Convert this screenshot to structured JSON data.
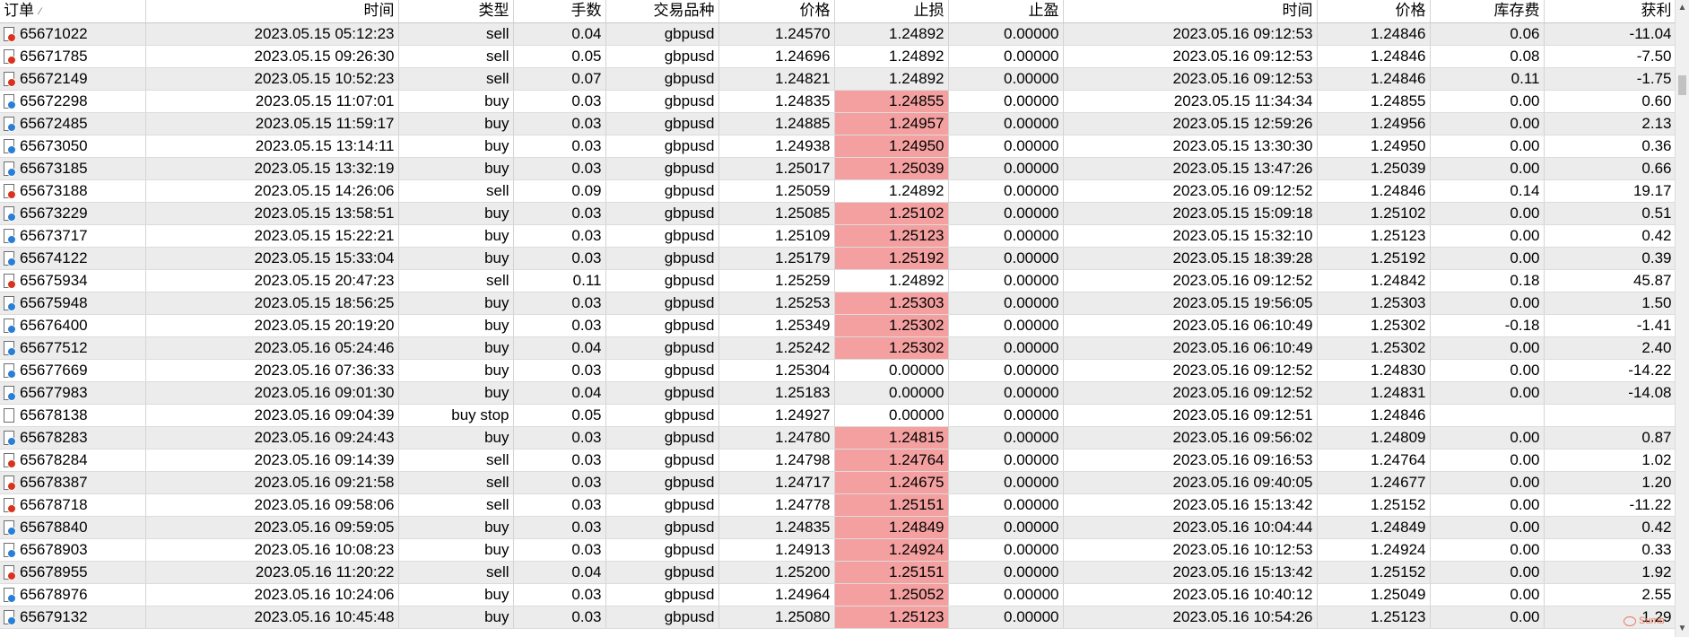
{
  "columns": {
    "order": "订单",
    "time_open": "时间",
    "type": "类型",
    "lots": "手数",
    "symbol": "交易品种",
    "price_open": "价格",
    "sl": "止损",
    "tp": "止盈",
    "time_close": "时间",
    "price_close": "价格",
    "swap": "库存费",
    "profit": "获利"
  },
  "sort_indicator": "⁄",
  "highlight_color": "#f4a0a0",
  "watermark": "Sumb",
  "rows": [
    {
      "order": "65671022",
      "time_open": "2023.05.15 05:12:23",
      "type": "sell",
      "lots": "0.04",
      "symbol": "gbpusd",
      "price_open": "1.24570",
      "sl": "1.24892",
      "tp": "0.00000",
      "time_close": "2023.05.16 09:12:53",
      "price_close": "1.24846",
      "swap": "0.06",
      "profit": "-11.04",
      "sl_hl": false
    },
    {
      "order": "65671785",
      "time_open": "2023.05.15 09:26:30",
      "type": "sell",
      "lots": "0.05",
      "symbol": "gbpusd",
      "price_open": "1.24696",
      "sl": "1.24892",
      "tp": "0.00000",
      "time_close": "2023.05.16 09:12:53",
      "price_close": "1.24846",
      "swap": "0.08",
      "profit": "-7.50",
      "sl_hl": false
    },
    {
      "order": "65672149",
      "time_open": "2023.05.15 10:52:23",
      "type": "sell",
      "lots": "0.07",
      "symbol": "gbpusd",
      "price_open": "1.24821",
      "sl": "1.24892",
      "tp": "0.00000",
      "time_close": "2023.05.16 09:12:53",
      "price_close": "1.24846",
      "swap": "0.11",
      "profit": "-1.75",
      "sl_hl": false
    },
    {
      "order": "65672298",
      "time_open": "2023.05.15 11:07:01",
      "type": "buy",
      "lots": "0.03",
      "symbol": "gbpusd",
      "price_open": "1.24835",
      "sl": "1.24855",
      "tp": "0.00000",
      "time_close": "2023.05.15 11:34:34",
      "price_close": "1.24855",
      "swap": "0.00",
      "profit": "0.60",
      "sl_hl": true
    },
    {
      "order": "65672485",
      "time_open": "2023.05.15 11:59:17",
      "type": "buy",
      "lots": "0.03",
      "symbol": "gbpusd",
      "price_open": "1.24885",
      "sl": "1.24957",
      "tp": "0.00000",
      "time_close": "2023.05.15 12:59:26",
      "price_close": "1.24956",
      "swap": "0.00",
      "profit": "2.13",
      "sl_hl": true
    },
    {
      "order": "65673050",
      "time_open": "2023.05.15 13:14:11",
      "type": "buy",
      "lots": "0.03",
      "symbol": "gbpusd",
      "price_open": "1.24938",
      "sl": "1.24950",
      "tp": "0.00000",
      "time_close": "2023.05.15 13:30:30",
      "price_close": "1.24950",
      "swap": "0.00",
      "profit": "0.36",
      "sl_hl": true
    },
    {
      "order": "65673185",
      "time_open": "2023.05.15 13:32:19",
      "type": "buy",
      "lots": "0.03",
      "symbol": "gbpusd",
      "price_open": "1.25017",
      "sl": "1.25039",
      "tp": "0.00000",
      "time_close": "2023.05.15 13:47:26",
      "price_close": "1.25039",
      "swap": "0.00",
      "profit": "0.66",
      "sl_hl": true
    },
    {
      "order": "65673188",
      "time_open": "2023.05.15 14:26:06",
      "type": "sell",
      "lots": "0.09",
      "symbol": "gbpusd",
      "price_open": "1.25059",
      "sl": "1.24892",
      "tp": "0.00000",
      "time_close": "2023.05.16 09:12:52",
      "price_close": "1.24846",
      "swap": "0.14",
      "profit": "19.17",
      "sl_hl": false
    },
    {
      "order": "65673229",
      "time_open": "2023.05.15 13:58:51",
      "type": "buy",
      "lots": "0.03",
      "symbol": "gbpusd",
      "price_open": "1.25085",
      "sl": "1.25102",
      "tp": "0.00000",
      "time_close": "2023.05.15 15:09:18",
      "price_close": "1.25102",
      "swap": "0.00",
      "profit": "0.51",
      "sl_hl": true
    },
    {
      "order": "65673717",
      "time_open": "2023.05.15 15:22:21",
      "type": "buy",
      "lots": "0.03",
      "symbol": "gbpusd",
      "price_open": "1.25109",
      "sl": "1.25123",
      "tp": "0.00000",
      "time_close": "2023.05.15 15:32:10",
      "price_close": "1.25123",
      "swap": "0.00",
      "profit": "0.42",
      "sl_hl": true
    },
    {
      "order": "65674122",
      "time_open": "2023.05.15 15:33:04",
      "type": "buy",
      "lots": "0.03",
      "symbol": "gbpusd",
      "price_open": "1.25179",
      "sl": "1.25192",
      "tp": "0.00000",
      "time_close": "2023.05.15 18:39:28",
      "price_close": "1.25192",
      "swap": "0.00",
      "profit": "0.39",
      "sl_hl": true
    },
    {
      "order": "65675934",
      "time_open": "2023.05.15 20:47:23",
      "type": "sell",
      "lots": "0.11",
      "symbol": "gbpusd",
      "price_open": "1.25259",
      "sl": "1.24892",
      "tp": "0.00000",
      "time_close": "2023.05.16 09:12:52",
      "price_close": "1.24842",
      "swap": "0.18",
      "profit": "45.87",
      "sl_hl": false
    },
    {
      "order": "65675948",
      "time_open": "2023.05.15 18:56:25",
      "type": "buy",
      "lots": "0.03",
      "symbol": "gbpusd",
      "price_open": "1.25253",
      "sl": "1.25303",
      "tp": "0.00000",
      "time_close": "2023.05.15 19:56:05",
      "price_close": "1.25303",
      "swap": "0.00",
      "profit": "1.50",
      "sl_hl": true
    },
    {
      "order": "65676400",
      "time_open": "2023.05.15 20:19:20",
      "type": "buy",
      "lots": "0.03",
      "symbol": "gbpusd",
      "price_open": "1.25349",
      "sl": "1.25302",
      "tp": "0.00000",
      "time_close": "2023.05.16 06:10:49",
      "price_close": "1.25302",
      "swap": "-0.18",
      "profit": "-1.41",
      "sl_hl": true
    },
    {
      "order": "65677512",
      "time_open": "2023.05.16 05:24:46",
      "type": "buy",
      "lots": "0.04",
      "symbol": "gbpusd",
      "price_open": "1.25242",
      "sl": "1.25302",
      "tp": "0.00000",
      "time_close": "2023.05.16 06:10:49",
      "price_close": "1.25302",
      "swap": "0.00",
      "profit": "2.40",
      "sl_hl": true
    },
    {
      "order": "65677669",
      "time_open": "2023.05.16 07:36:33",
      "type": "buy",
      "lots": "0.03",
      "symbol": "gbpusd",
      "price_open": "1.25304",
      "sl": "0.00000",
      "tp": "0.00000",
      "time_close": "2023.05.16 09:12:52",
      "price_close": "1.24830",
      "swap": "0.00",
      "profit": "-14.22",
      "sl_hl": false
    },
    {
      "order": "65677983",
      "time_open": "2023.05.16 09:01:30",
      "type": "buy",
      "lots": "0.04",
      "symbol": "gbpusd",
      "price_open": "1.25183",
      "sl": "0.00000",
      "tp": "0.00000",
      "time_close": "2023.05.16 09:12:52",
      "price_close": "1.24831",
      "swap": "0.00",
      "profit": "-14.08",
      "sl_hl": false
    },
    {
      "order": "65678138",
      "time_open": "2023.05.16 09:04:39",
      "type": "buy stop",
      "lots": "0.05",
      "symbol": "gbpusd",
      "price_open": "1.24927",
      "sl": "0.00000",
      "tp": "0.00000",
      "time_close": "2023.05.16 09:12:51",
      "price_close": "1.24846",
      "swap": "",
      "profit": "",
      "sl_hl": false
    },
    {
      "order": "65678283",
      "time_open": "2023.05.16 09:24:43",
      "type": "buy",
      "lots": "0.03",
      "symbol": "gbpusd",
      "price_open": "1.24780",
      "sl": "1.24815",
      "tp": "0.00000",
      "time_close": "2023.05.16 09:56:02",
      "price_close": "1.24809",
      "swap": "0.00",
      "profit": "0.87",
      "sl_hl": true
    },
    {
      "order": "65678284",
      "time_open": "2023.05.16 09:14:39",
      "type": "sell",
      "lots": "0.03",
      "symbol": "gbpusd",
      "price_open": "1.24798",
      "sl": "1.24764",
      "tp": "0.00000",
      "time_close": "2023.05.16 09:16:53",
      "price_close": "1.24764",
      "swap": "0.00",
      "profit": "1.02",
      "sl_hl": true
    },
    {
      "order": "65678387",
      "time_open": "2023.05.16 09:21:58",
      "type": "sell",
      "lots": "0.03",
      "symbol": "gbpusd",
      "price_open": "1.24717",
      "sl": "1.24675",
      "tp": "0.00000",
      "time_close": "2023.05.16 09:40:05",
      "price_close": "1.24677",
      "swap": "0.00",
      "profit": "1.20",
      "sl_hl": true
    },
    {
      "order": "65678718",
      "time_open": "2023.05.16 09:58:06",
      "type": "sell",
      "lots": "0.03",
      "symbol": "gbpusd",
      "price_open": "1.24778",
      "sl": "1.25151",
      "tp": "0.00000",
      "time_close": "2023.05.16 15:13:42",
      "price_close": "1.25152",
      "swap": "0.00",
      "profit": "-11.22",
      "sl_hl": true
    },
    {
      "order": "65678840",
      "time_open": "2023.05.16 09:59:05",
      "type": "buy",
      "lots": "0.03",
      "symbol": "gbpusd",
      "price_open": "1.24835",
      "sl": "1.24849",
      "tp": "0.00000",
      "time_close": "2023.05.16 10:04:44",
      "price_close": "1.24849",
      "swap": "0.00",
      "profit": "0.42",
      "sl_hl": true
    },
    {
      "order": "65678903",
      "time_open": "2023.05.16 10:08:23",
      "type": "buy",
      "lots": "0.03",
      "symbol": "gbpusd",
      "price_open": "1.24913",
      "sl": "1.24924",
      "tp": "0.00000",
      "time_close": "2023.05.16 10:12:53",
      "price_close": "1.24924",
      "swap": "0.00",
      "profit": "0.33",
      "sl_hl": true
    },
    {
      "order": "65678955",
      "time_open": "2023.05.16 11:20:22",
      "type": "sell",
      "lots": "0.04",
      "symbol": "gbpusd",
      "price_open": "1.25200",
      "sl": "1.25151",
      "tp": "0.00000",
      "time_close": "2023.05.16 15:13:42",
      "price_close": "1.25152",
      "swap": "0.00",
      "profit": "1.92",
      "sl_hl": true
    },
    {
      "order": "65678976",
      "time_open": "2023.05.16 10:24:06",
      "type": "buy",
      "lots": "0.03",
      "symbol": "gbpusd",
      "price_open": "1.24964",
      "sl": "1.25052",
      "tp": "0.00000",
      "time_close": "2023.05.16 10:40:12",
      "price_close": "1.25049",
      "swap": "0.00",
      "profit": "2.55",
      "sl_hl": true
    },
    {
      "order": "65679132",
      "time_open": "2023.05.16 10:45:48",
      "type": "buy",
      "lots": "0.03",
      "symbol": "gbpusd",
      "price_open": "1.25080",
      "sl": "1.25123",
      "tp": "0.00000",
      "time_close": "2023.05.16 10:54:26",
      "price_close": "1.25123",
      "swap": "0.00",
      "profit": "1.29",
      "sl_hl": true
    }
  ]
}
